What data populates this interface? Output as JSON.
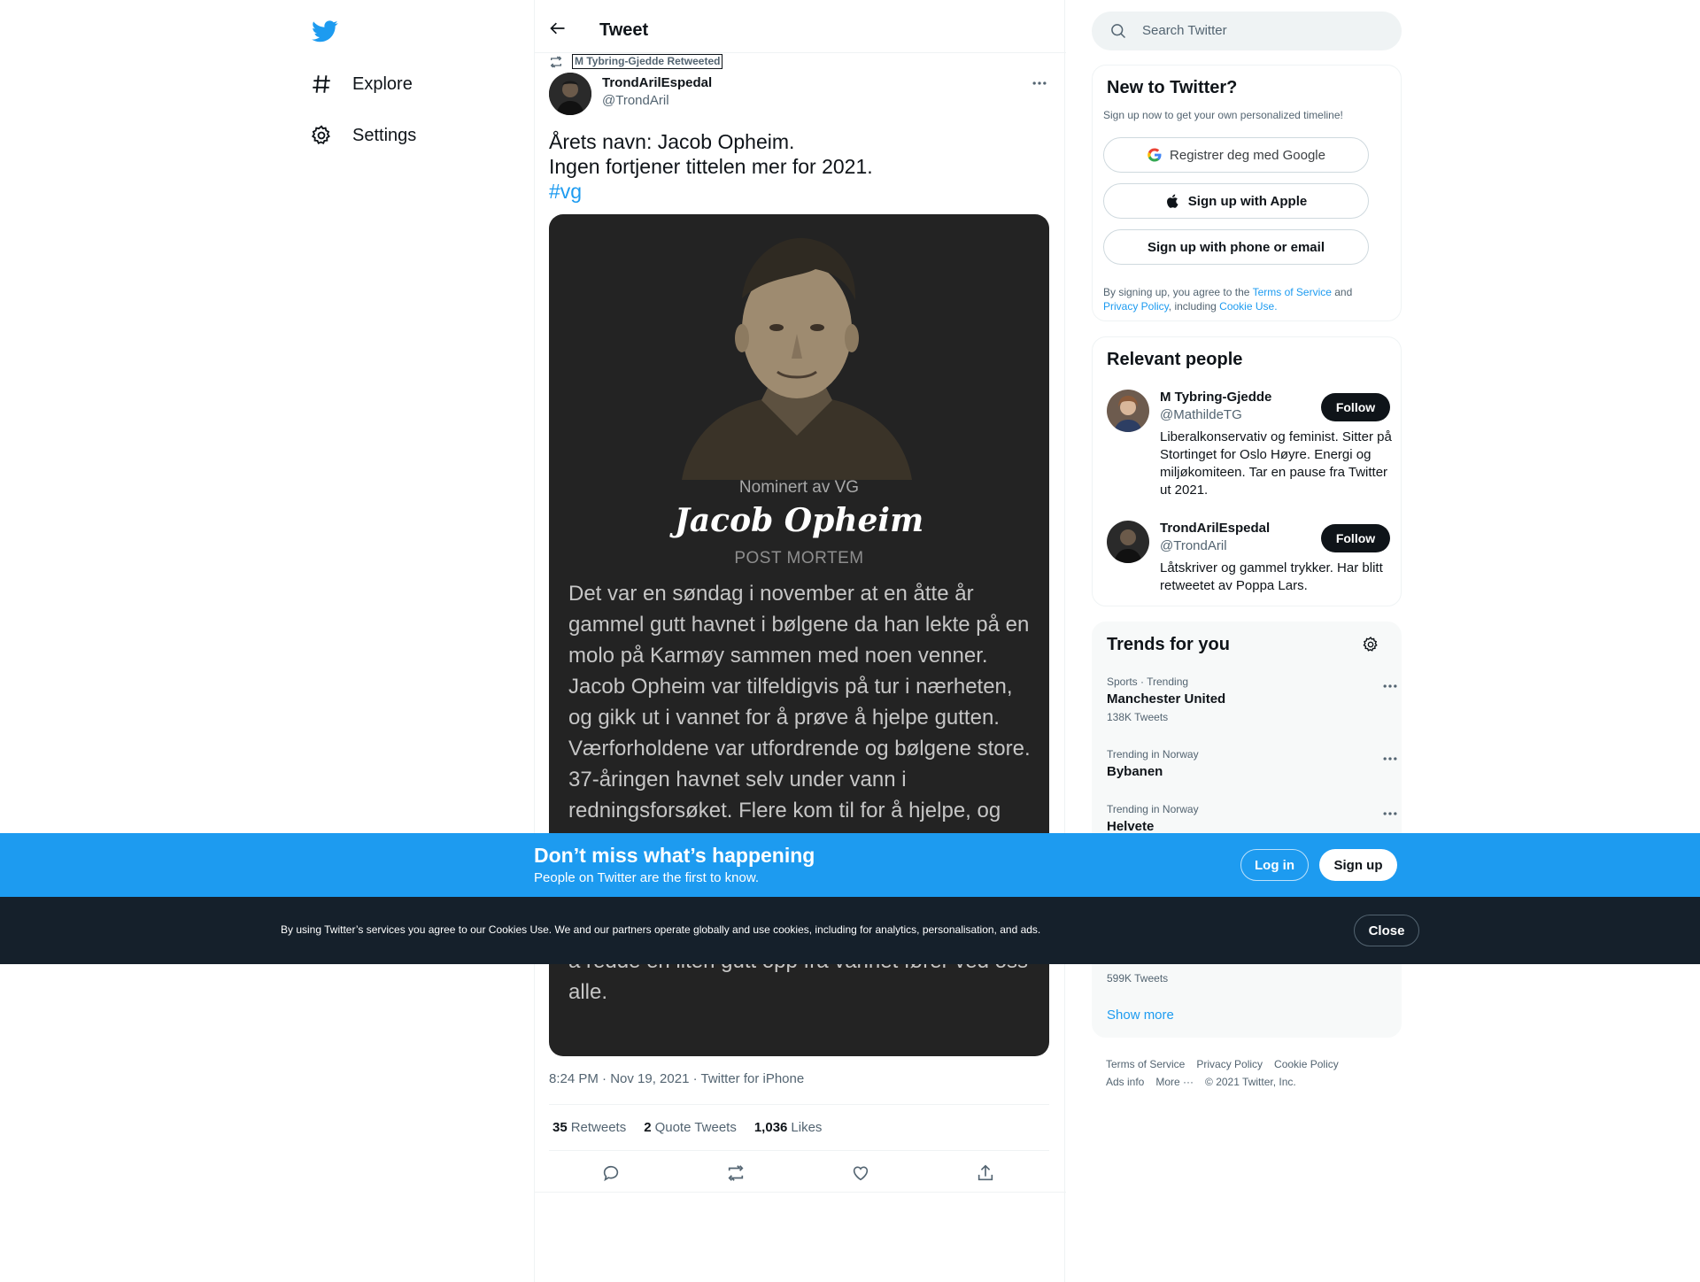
{
  "nav": {
    "explore_label": "Explore",
    "settings_label": "Settings"
  },
  "header": {
    "title": "Tweet"
  },
  "tweet": {
    "retweeted_by": "M Tybring-Gjedde Retweeted",
    "author_name": "TrondArilEspedal",
    "author_handle": "@TrondAril",
    "text_line1": "Årets navn: Jacob Opheim.",
    "text_line2": "Ingen fortjener tittelen mer for 2021.",
    "hashtag": "#vg",
    "card": {
      "nominated": "Nominert av VG",
      "name": "Jacob Opheim",
      "subtitle": "POST MORTEM",
      "story": "Det var en søndag i november at en åtte år gammel gutt havnet i bølgene da han lekte på en molo på Karmøy sammen med noen venner. Jacob Opheim var tilfeldigvis på tur i nærheten, og gikk ut i vannet for å prøve å hjelpe gutten. Værforholdene var utfordrende og bølgene store. 37-åringen havnet selv under vann i redningsforsøket. Flere kom til for å hjelpe, og",
      "story_end": "å redde en liten gutt opp fra vannet fører ved oss alle."
    },
    "meta": "8:24 PM · Nov 19, 2021 · Twitter for iPhone",
    "stats": {
      "retweets_num": "35",
      "retweets_label": "Retweets",
      "quotes_num": "2",
      "quotes_label": "Quote Tweets",
      "likes_num": "1,036",
      "likes_label": "Likes"
    }
  },
  "search": {
    "placeholder": "Search Twitter"
  },
  "new_to_twitter": {
    "title": "New to Twitter?",
    "subtitle": "Sign up now to get your own personalized timeline!",
    "google": "Registrer deg med Google",
    "apple": "Sign up with Apple",
    "phone": "Sign up with phone or email",
    "terms_a": "By signing up, you agree to the ",
    "terms_tos": "Terms of Service",
    "terms_and": " and ",
    "terms_pp": "Privacy Policy",
    "terms_including": ", including ",
    "terms_cookie": "Cookie Use."
  },
  "relevant": {
    "title": "Relevant people",
    "people": [
      {
        "name": "M Tybring-Gjedde",
        "handle": "@MathildeTG",
        "bio": "Liberalkonservativ og feminist. Sitter på Stortinget for Oslo Høyre. Energi og miljøkomiteen. Tar en pause fra Twitter ut 2021.",
        "follow": "Follow"
      },
      {
        "name": "TrondArilEspedal",
        "handle": "@TrondAril",
        "bio": "Låtskriver og gammel trykker. Har blitt retweetet av Poppa Lars.",
        "follow": "Follow"
      }
    ]
  },
  "trends": {
    "title": "Trends for you",
    "items": [
      {
        "context": "Sports · Trending",
        "name": "Manchester United",
        "count": "138K Tweets"
      },
      {
        "context": "Trending in Norway",
        "name": "Bybanen"
      },
      {
        "context": "Trending in Norway",
        "name": "Helvete"
      }
    ],
    "hidden_count": "599K Tweets",
    "show_more": "Show more"
  },
  "footer": {
    "tos": "Terms of Service",
    "privacy": "Privacy Policy",
    "cookie": "Cookie Policy",
    "ads": "Ads info",
    "more": "More ···",
    "copyright": "© 2021 Twitter, Inc."
  },
  "banner": {
    "title": "Don’t miss what’s happening",
    "subtitle": "People on Twitter are the first to know.",
    "login": "Log in",
    "signup": "Sign up"
  },
  "cookie": {
    "text": "By using Twitter’s services you agree to our Cookies Use. We and our partners operate globally and use cookies, including for analytics, personalisation, and ads.",
    "close": "Close"
  },
  "colors": {
    "accent": "#1d9bf0",
    "text": "#0f1419",
    "secondary": "#536471",
    "cookie_bg": "#15202b"
  }
}
